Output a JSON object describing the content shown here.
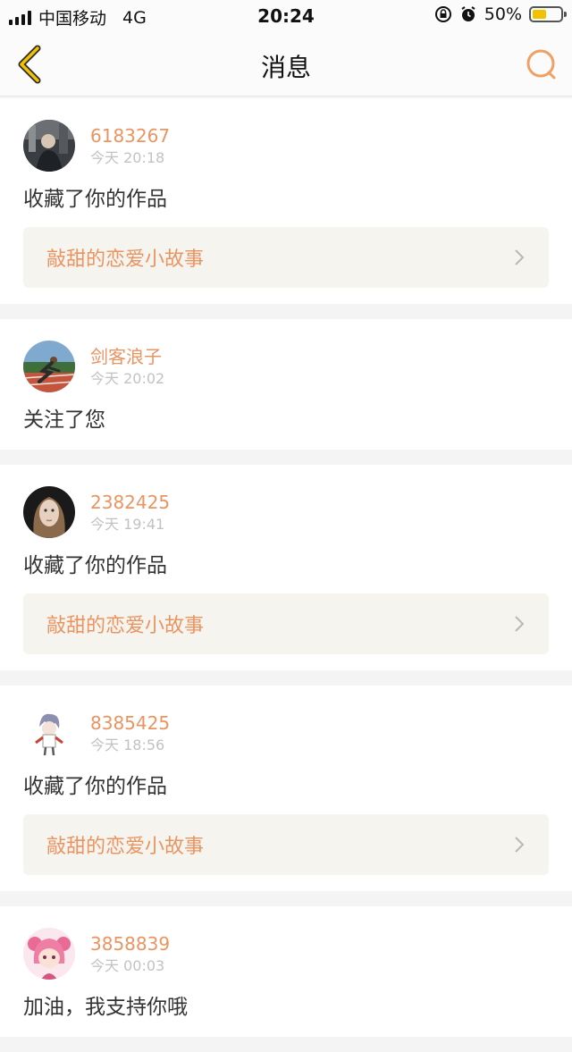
{
  "status": {
    "carrier": "中国移动",
    "network": "4G",
    "time": "20:24",
    "battery": "50%",
    "battery_level": 0.5
  },
  "nav": {
    "title": "消息",
    "back_icon": "chevron-left-icon",
    "search_icon": "search-icon",
    "accent": "#f2c200"
  },
  "colors": {
    "username": "#e99461",
    "timestamp": "#c2c2c2",
    "work_bg": "#f5f4ef"
  },
  "messages": [
    {
      "user": "6183267",
      "time": "今天 20:18",
      "action": "收藏了你的作品",
      "work": "敲甜的恋爱小故事"
    },
    {
      "user": "剑客浪子",
      "time": "今天 20:02",
      "action": "关注了您",
      "work": null
    },
    {
      "user": "2382425",
      "time": "今天 19:41",
      "action": "收藏了你的作品",
      "work": "敲甜的恋爱小故事"
    },
    {
      "user": "8385425",
      "time": "今天 18:56",
      "action": "收藏了你的作品",
      "work": "敲甜的恋爱小故事"
    },
    {
      "user": "3858839",
      "time": "今天 00:03",
      "action": "加油，我支持你哦",
      "work": null
    }
  ]
}
